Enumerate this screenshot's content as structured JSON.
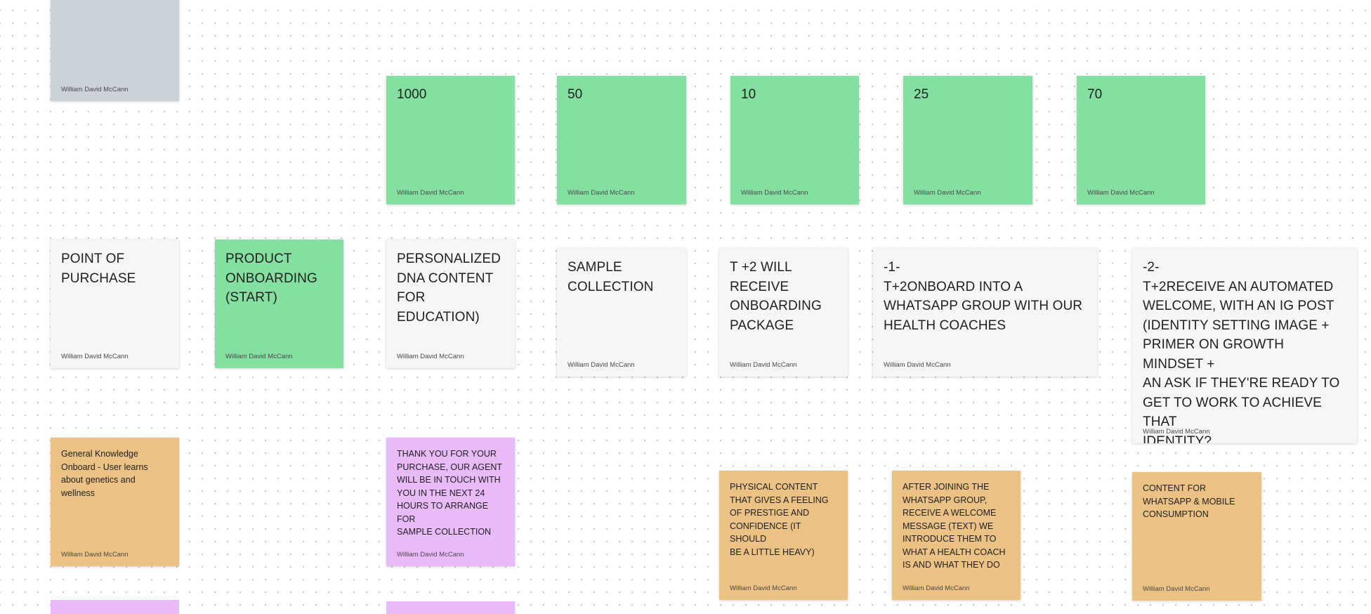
{
  "author": "William David McCann",
  "colors": {
    "grey": "#cdd1d8",
    "green": "#84e0a0",
    "white": "#f6f6f6",
    "orange": "#ebc184",
    "pink": "#e8baf7"
  },
  "stickies": {
    "top_grey": {
      "text": ""
    },
    "count_1000": {
      "text": "1000"
    },
    "count_50": {
      "text": "50"
    },
    "count_10": {
      "text": "10"
    },
    "count_25": {
      "text": "25"
    },
    "count_70": {
      "text": "70"
    },
    "point_of_purchase": {
      "text": "POINT OF\nPURCHASE"
    },
    "product_onboarding": {
      "text": "PRODUCT\nONBOARDING\n(START)"
    },
    "personalized_dna": {
      "text": "PERSONALIZED\nDNA CONTENT\nFOR EDUCATION)"
    },
    "sample_collection": {
      "text": "SAMPLE\nCOLLECTION"
    },
    "onboarding_package": {
      "text": "T +2 WILL\nRECEIVE\nONBOARDING\nPACKAGE"
    },
    "whatsapp_group": {
      "text": "-1-\nT+2ONBOARD INTO A\nWHATSAPP GROUP WITH OUR\nHEALTH COACHES"
    },
    "automated_welcome": {
      "text": "-2-\nT+2RECEIVE AN AUTOMATED\nWELCOME, WITH AN IG POST\n(IDENTITY SETTING IMAGE +\nPRIMER ON GROWTH MINDSET +\nAN ASK IF THEY'RE READY TO\nGET TO WORK TO ACHIEVE THAT\nIDENTITY?"
    },
    "general_knowledge": {
      "text": "General Knowledge\nOnboard - User learns\nabout genetics and\nwellness"
    },
    "thank_you": {
      "text": "THANK YOU FOR YOUR\nPURCHASE, OUR AGENT\nWILL BE IN TOUCH WITH\nYOU IN THE NEXT 24\nHOURS TO ARRANGE FOR\nSAMPLE COLLECTION"
    },
    "physical_content": {
      "text": "PHYSICAL CONTENT\nTHAT GIVES A FEELING\nOF PRESTIGE AND\nCONFIDENCE (IT SHOULD\nBE A LITTLE HEAVY)"
    },
    "after_joining": {
      "text": "AFTER JOINING THE\nWHATSAPP GROUP,\nRECEIVE A WELCOME\nMESSAGE (TEXT) WE\nINTRODUCE THEM TO\nWHAT A HEALTH COACH\nIS AND WHAT THEY DO"
    },
    "whatsapp_mobile": {
      "text": "CONTENT FOR\nWHATSAPP & MOBILE\nCONSUMPTION"
    },
    "bottom_pink_left": {
      "text": ""
    },
    "bottom_pink_mid": {
      "text": ""
    }
  }
}
